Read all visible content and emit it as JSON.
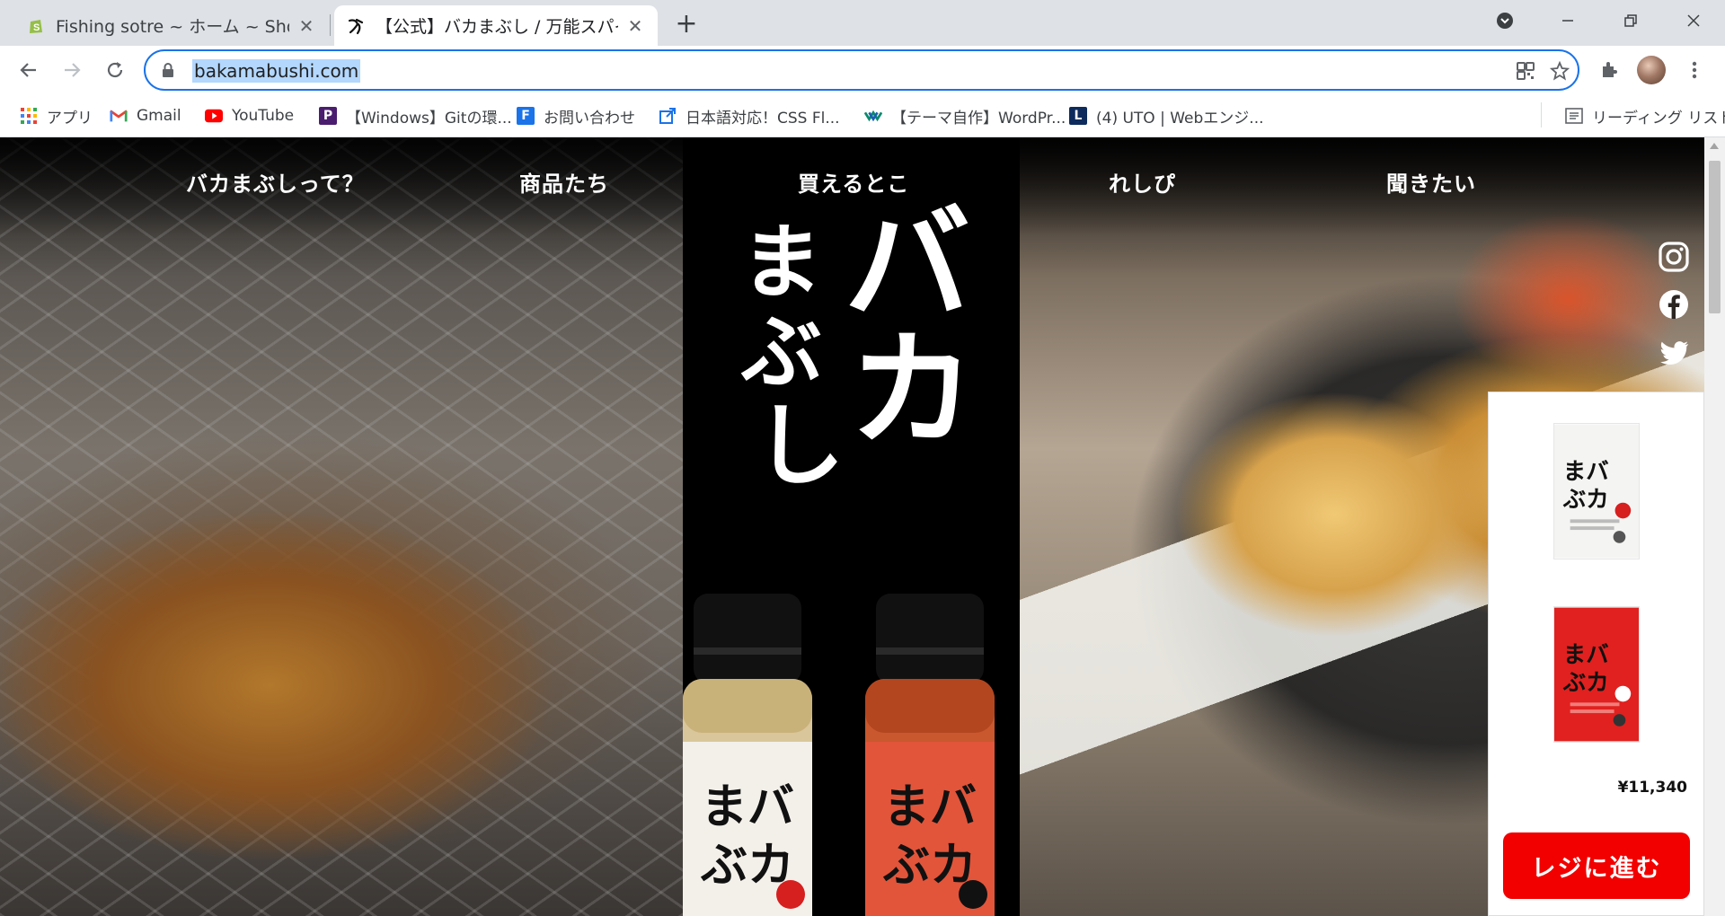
{
  "browser": {
    "tabs": [
      {
        "title": "Fishing sotre ~ ホーム ~ Shopify",
        "icon": "shopify-icon",
        "active": false
      },
      {
        "title": "【公式】バカまぶし / 万能スパイス バカ",
        "icon": "bakamabushi-favicon",
        "active": true
      }
    ],
    "new_tab_label": "+",
    "url": "bakamabushi.com",
    "bookmarks": [
      {
        "label": "アプリ",
        "icon": "apps-grid-icon"
      },
      {
        "label": "Gmail",
        "icon": "gmail-icon"
      },
      {
        "label": "YouTube",
        "icon": "youtube-icon"
      },
      {
        "label": "【Windows】Gitの環...",
        "icon": "bookmark-p-icon"
      },
      {
        "label": "お問い合わせ",
        "icon": "bookmark-f-icon"
      },
      {
        "label": "日本語対応！CSS Fl...",
        "icon": "bookmark-external-icon"
      },
      {
        "label": "【テーマ自作】WordPr...",
        "icon": "bookmark-w-icon"
      },
      {
        "label": "(4) UTO | Webエンジ...",
        "icon": "bookmark-l-icon"
      }
    ],
    "reading_list_label": "リーディング リスト"
  },
  "site": {
    "nav": [
      {
        "label": "バカまぶしって？"
      },
      {
        "label": "商品たち"
      },
      {
        "label": "買えるとこ"
      },
      {
        "label": "れしぴ"
      },
      {
        "label": "聞きたい"
      }
    ],
    "logo_text": "バカまぶし",
    "social": [
      "instagram-icon",
      "facebook-icon",
      "twitter-icon"
    ],
    "cart": {
      "total": "¥11,340",
      "checkout_label": "レジに進む"
    },
    "colors": {
      "accent_red": "#f20000",
      "omnibox_focus": "#1a73e8"
    }
  }
}
